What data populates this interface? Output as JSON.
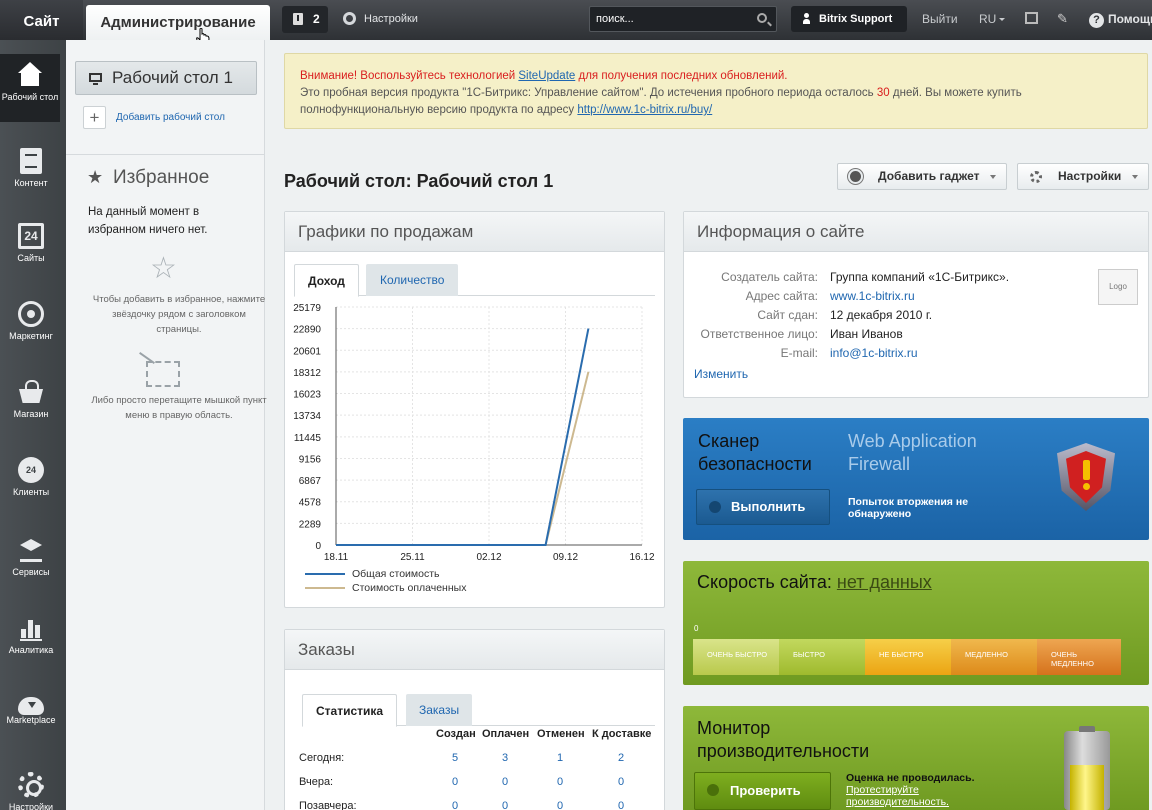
{
  "topbar": {
    "site_tab": "Сайт",
    "admin_tab": "Администрирование",
    "notifications_count": "2",
    "settings_label": "Настройки",
    "search_placeholder": "поиск...",
    "user_name": "Bitrix Support",
    "logout_label": "Выйти",
    "lang_label": "RU",
    "help_label": "Помощь"
  },
  "nav": {
    "items": [
      {
        "label": "Рабочий стол",
        "icon": "home-icon"
      },
      {
        "label": "Контент",
        "icon": "document-icon"
      },
      {
        "label": "Сайты",
        "icon": "calendar-24-icon",
        "glyph": "24"
      },
      {
        "label": "Маркетинг",
        "icon": "target-icon"
      },
      {
        "label": "Магазин",
        "icon": "basket-icon"
      },
      {
        "label": "Клиенты",
        "icon": "clients-24-icon",
        "glyph": "24"
      },
      {
        "label": "Сервисы",
        "icon": "layers-icon"
      },
      {
        "label": "Аналитика",
        "icon": "bar-chart-icon"
      },
      {
        "label": "Marketplace",
        "icon": "cloud-download-icon"
      },
      {
        "label": "Настройки",
        "icon": "gear-icon"
      }
    ]
  },
  "leftpanel": {
    "desktop_button": "Рабочий стол 1",
    "add_desktop": "Добавить рабочий стол",
    "favorites_title": "Избранное",
    "favorites_empty": "На данный момент в избранном ничего нет.",
    "favorites_hint1": "Чтобы добавить в избранное, нажмите звёздочку рядом с заголовком страницы.",
    "favorites_hint2": "Либо просто перетащите мышкой пункт меню в правую область."
  },
  "warning": {
    "alert": "Внимание! Воспользуйтесь технологией",
    "link1": "SiteUpdate",
    "alert_tail": "для получения последних обновлений.",
    "line2a": "Это пробная версия продукта \"1С-Битрикс: Управление сайтом\". До истечения пробного периода осталось",
    "days": "30",
    "line2b": "дней. Вы можете купить полнофункциональную версию продукта по адресу",
    "link2": "http://www.1c-bitrix.ru/buy/"
  },
  "page_title": "Рабочий стол: Рабочий стол 1",
  "toolbar": {
    "add_gadget": "Добавить гаджет",
    "settings": "Настройки"
  },
  "sales": {
    "title": "Графики по продажам",
    "tabs": [
      "Доход",
      "Количество"
    ],
    "legend": [
      "Общая стоимость",
      "Стоимость оплаченных"
    ]
  },
  "chart_data": {
    "type": "line",
    "x": [
      "18.11",
      "25.11",
      "02.12",
      "09.12",
      "16.12"
    ],
    "ylim": [
      0,
      25179
    ],
    "yticks": [
      "25179",
      "22890",
      "20601",
      "18312",
      "16023",
      "13734",
      "11445",
      "9156",
      "6867",
      "4578",
      "2289",
      "0"
    ],
    "series": [
      {
        "name": "Общая стоимость",
        "color": "#2a6cae",
        "points": [
          [
            0,
            0
          ],
          [
            1,
            0
          ],
          [
            2,
            0
          ],
          [
            2.74,
            0
          ],
          [
            3.3,
            22890
          ]
        ]
      },
      {
        "name": "Стоимость оплаченных",
        "color": "#cdb990",
        "points": [
          [
            0,
            0
          ],
          [
            1,
            0
          ],
          [
            2,
            0
          ],
          [
            2.74,
            0
          ],
          [
            3.3,
            18312
          ]
        ]
      }
    ]
  },
  "orders": {
    "title": "Заказы",
    "tabs": [
      "Статистика",
      "Заказы"
    ],
    "columns": [
      "Создан",
      "Оплачен",
      "Отменен",
      "К доставке"
    ],
    "rows": [
      {
        "label": "Сегодня:",
        "values": [
          "5",
          "3",
          "1",
          "2"
        ]
      },
      {
        "label": "Вчера:",
        "values": [
          "0",
          "0",
          "0",
          "0"
        ]
      },
      {
        "label": "Позавчера:",
        "values": [
          "0",
          "0",
          "0",
          "0"
        ]
      }
    ]
  },
  "siteinfo": {
    "title": "Информация о сайте",
    "rows": [
      {
        "k": "Создатель сайта:",
        "v": "Группа компаний «1С-Битрикс».",
        "link": false
      },
      {
        "k": "Адрес сайта:",
        "v": "www.1c-bitrix.ru",
        "link": true
      },
      {
        "k": "Сайт сдан:",
        "v": "12 декабря 2010 г.",
        "link": false
      },
      {
        "k": "Ответственное лицо:",
        "v": "Иван Иванов",
        "link": false
      },
      {
        "k": "E-mail:",
        "v": "info@1c-bitrix.ru",
        "link": true
      }
    ],
    "logo": "Logo",
    "edit": "Изменить"
  },
  "scanner": {
    "title": "Сканер безопасности",
    "waf": "Web Application Firewall",
    "button": "Выполнить",
    "note": "Попыток вторжения не обнаружено"
  },
  "speed": {
    "title": "Скорость сайта:",
    "value": "нет данных",
    "zero": "0",
    "segments": [
      "очень быстро",
      "быстро",
      "не быстро",
      "медленно",
      "очень медленно"
    ]
  },
  "perf": {
    "title": "Монитор производительности",
    "button": "Проверить",
    "note": "Оценка не проводилась.",
    "link": "Протестируйте производительность."
  }
}
